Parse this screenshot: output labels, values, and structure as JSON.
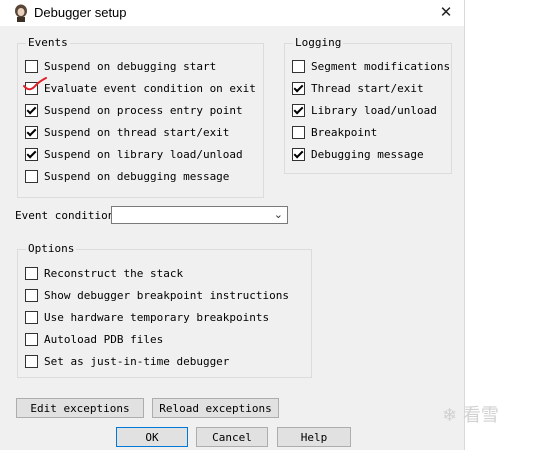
{
  "window": {
    "title": "Debugger setup",
    "close_glyph": "✕"
  },
  "events": {
    "title": "Events",
    "items": [
      {
        "label": "Suspend on debugging start",
        "checked": false
      },
      {
        "label": "Evaluate event condition on exit",
        "checked": false
      },
      {
        "label": "Suspend on process entry point",
        "checked": true
      },
      {
        "label": "Suspend on thread start/exit",
        "checked": true
      },
      {
        "label": "Suspend on library load/unload",
        "checked": true
      },
      {
        "label": "Suspend on debugging message",
        "checked": false
      }
    ]
  },
  "logging": {
    "title": "Logging",
    "items": [
      {
        "label": "Segment modifications",
        "checked": false
      },
      {
        "label": "Thread start/exit",
        "checked": true
      },
      {
        "label": "Library load/unload",
        "checked": true
      },
      {
        "label": "Breakpoint",
        "checked": false
      },
      {
        "label": "Debugging message",
        "checked": true
      }
    ]
  },
  "event_condition": {
    "label": "Event condition",
    "value": ""
  },
  "options": {
    "title": "Options",
    "items": [
      {
        "label": "Reconstruct the stack",
        "checked": false
      },
      {
        "label": "Show debugger breakpoint instructions",
        "checked": false
      },
      {
        "label": "Use hardware temporary breakpoints",
        "checked": false
      },
      {
        "label": "Autoload PDB files",
        "checked": false
      },
      {
        "label": "Set as just-in-time debugger",
        "checked": false
      }
    ]
  },
  "buttons": {
    "edit_exceptions": "Edit exceptions",
    "reload_exceptions": "Reload exceptions",
    "ok": "OK",
    "cancel": "Cancel",
    "help": "Help"
  },
  "watermark": {
    "text": "看雪"
  },
  "colors": {
    "dialog_bg": "#f0f0f0",
    "annotation_red": "#e0202a",
    "default_button_border": "#0078d7"
  }
}
